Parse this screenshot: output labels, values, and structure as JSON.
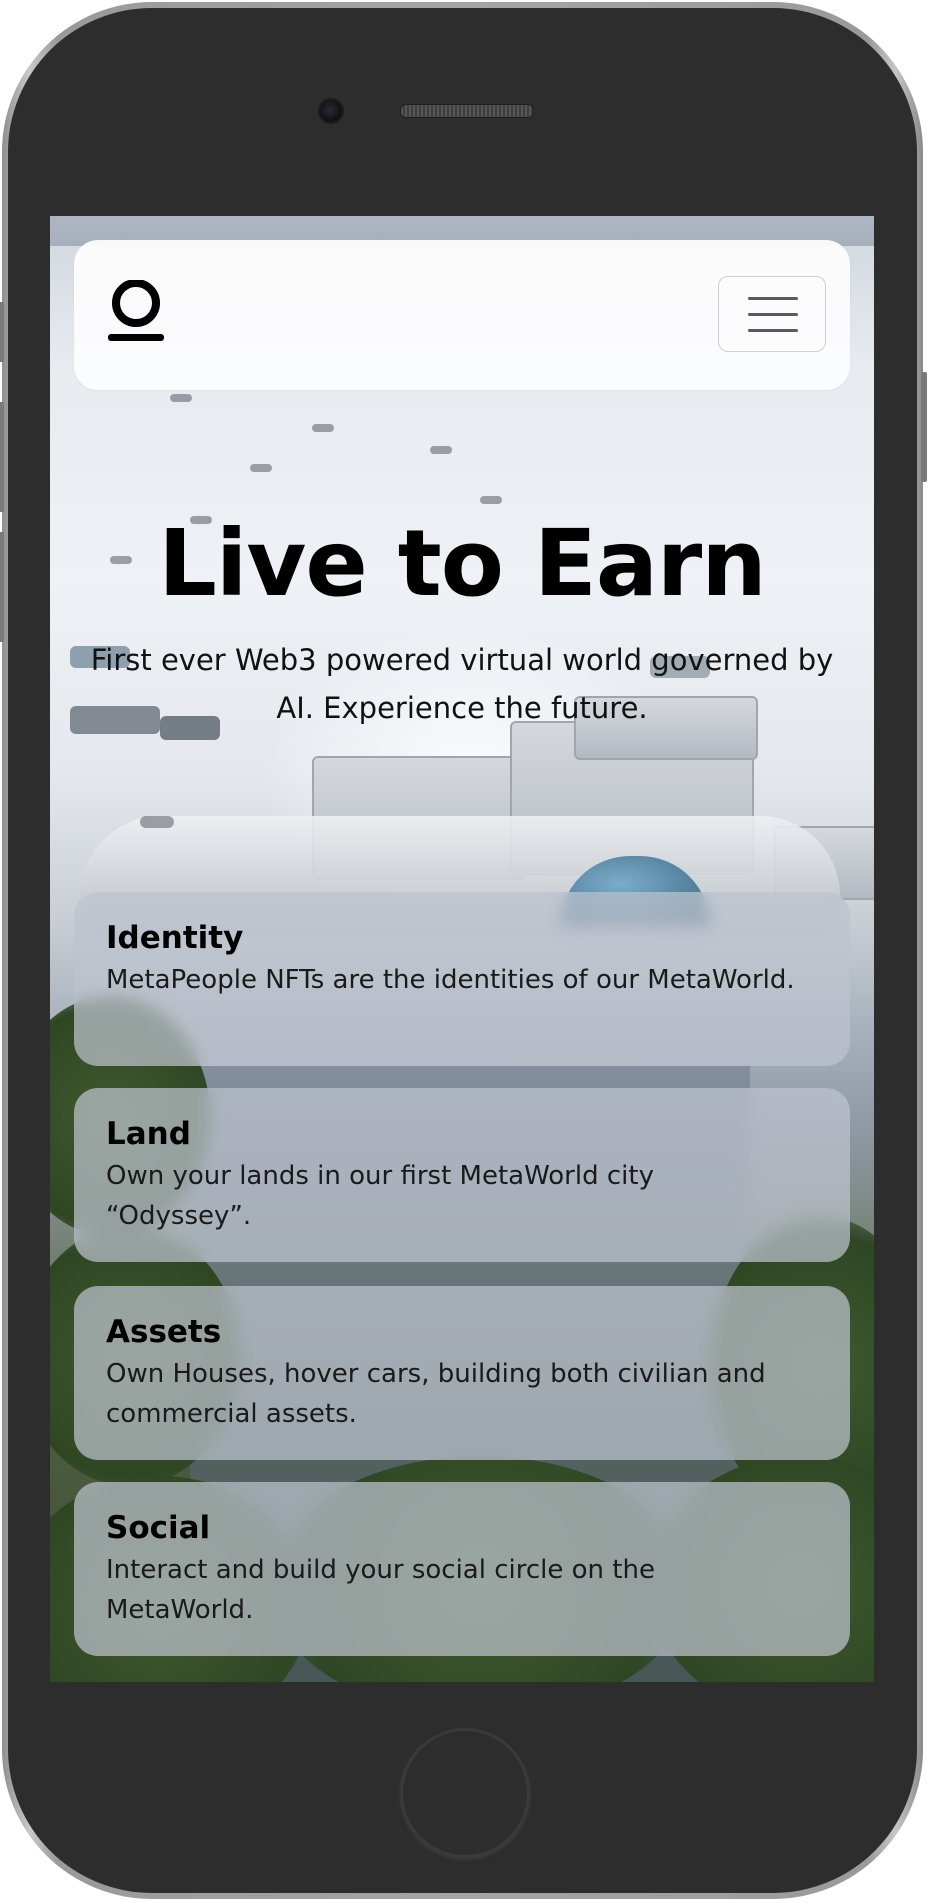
{
  "hero": {
    "title": "Live to Earn",
    "subtitle": "First ever Web3 powered virtual world governed by AI. Experience the future."
  },
  "navbar": {
    "logo_icon": "metaworld-logo-icon",
    "menu_icon": "hamburger-menu-icon"
  },
  "features": [
    {
      "title": "Identity",
      "text": "MetaPeople NFTs are the identities of our MetaWorld."
    },
    {
      "title": "Land",
      "text": "Own your lands in our first MetaWorld city “Odyssey”."
    },
    {
      "title": "Assets",
      "text": "Own Houses, hover cars, building both civilian and commercial assets."
    },
    {
      "title": "Social",
      "text": "Interact and build your social circle on the MetaWorld."
    }
  ]
}
